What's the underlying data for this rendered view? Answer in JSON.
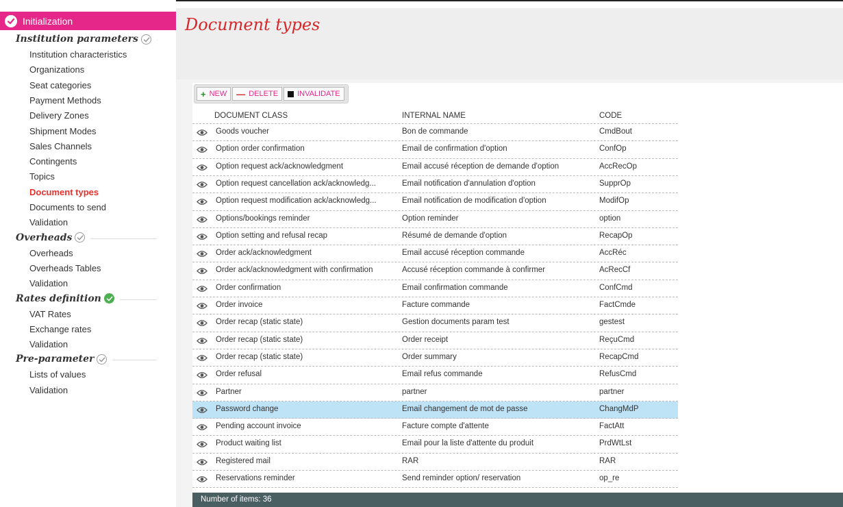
{
  "sidebar": {
    "header": "Initialization",
    "sections": [
      {
        "title": "Institution parameters",
        "done": false,
        "items": [
          "Institution characteristics",
          "Organizations",
          "Seat categories",
          "Payment Methods",
          "Delivery Zones",
          "Shipment Modes",
          "Sales Channels",
          "Contingents",
          "Topics",
          "Document types",
          "Documents to send",
          "Validation"
        ]
      },
      {
        "title": "Overheads",
        "done": false,
        "items": [
          "Overheads",
          "Overheads Tables",
          "Validation"
        ]
      },
      {
        "title": "Rates definition",
        "done": true,
        "items": [
          "VAT Rates",
          "Exchange rates",
          "Validation"
        ]
      },
      {
        "title": "Pre-parameter",
        "done": false,
        "items": [
          "Lists of values",
          "Validation"
        ]
      }
    ],
    "active_item": "Document types"
  },
  "page": {
    "title": "Document types"
  },
  "toolbar": {
    "new_label": "NEW",
    "delete_label": "DELETE",
    "invalidate_label": "INVALIDATE"
  },
  "table": {
    "columns": [
      "DOCUMENT CLASS",
      "INTERNAL NAME",
      "CODE"
    ],
    "selected_index": 17,
    "rows": [
      [
        "Goods voucher",
        "Bon de commande",
        "CmdBout"
      ],
      [
        "Option order confirmation",
        "Email de confirmation d'option",
        "ConfOp"
      ],
      [
        "Option request ack/acknowledgment",
        "Email accusé réception de demande d'option",
        "AccRecOp"
      ],
      [
        "Option request cancellation ack/acknowledg...",
        "Email notification d'annulation d'option",
        "SupprOp"
      ],
      [
        "Option request modification ack/acknowledg...",
        "Email notification de modification d'option",
        "ModifOp"
      ],
      [
        "Options/bookings reminder",
        "Option reminder",
        "option"
      ],
      [
        "Option setting and refusal recap",
        "Résumé de demande d'option",
        "RecapOp"
      ],
      [
        "Order ack/acknowledgment",
        "Email accusé réception commande",
        "AccRéc"
      ],
      [
        "Order ack/acknowledgment with confirmation",
        "Accusé réception commande à confirmer",
        "AcRecCf"
      ],
      [
        "Order confirmation",
        "Email confirmation commande",
        "ConfCmd"
      ],
      [
        "Order invoice",
        "Facture commande",
        "FactCmde"
      ],
      [
        "Order recap (static state)",
        "Gestion documents param test",
        "gestest"
      ],
      [
        "Order recap (static state)",
        "Order receipt",
        "ReçuCmd"
      ],
      [
        "Order recap (static state)",
        "Order summary",
        "RecapCmd"
      ],
      [
        "Order refusal",
        "Email refus commande",
        "RefusCmd"
      ],
      [
        "Partner",
        "partner",
        "partner"
      ],
      [
        "Password change",
        "Email changement de mot de passe",
        "ChangMdP"
      ],
      [
        "Pending account invoice",
        "Facture compte d'attente",
        "FactAtt"
      ],
      [
        "Product waiting list",
        "Email pour la liste d'attente du produit",
        "PrdWtLst"
      ],
      [
        "Registered mail",
        "RAR",
        "RAR"
      ],
      [
        "Reservations reminder",
        "Send reminder option/ reservation",
        "op_re"
      ]
    ]
  },
  "footer": {
    "text": "Number of items: 36"
  },
  "colors": {
    "brand_pink": "#e6278a",
    "title_red": "#d6272a",
    "selected_row": "#bfe3f6",
    "footer_bg": "#4a5f62"
  }
}
